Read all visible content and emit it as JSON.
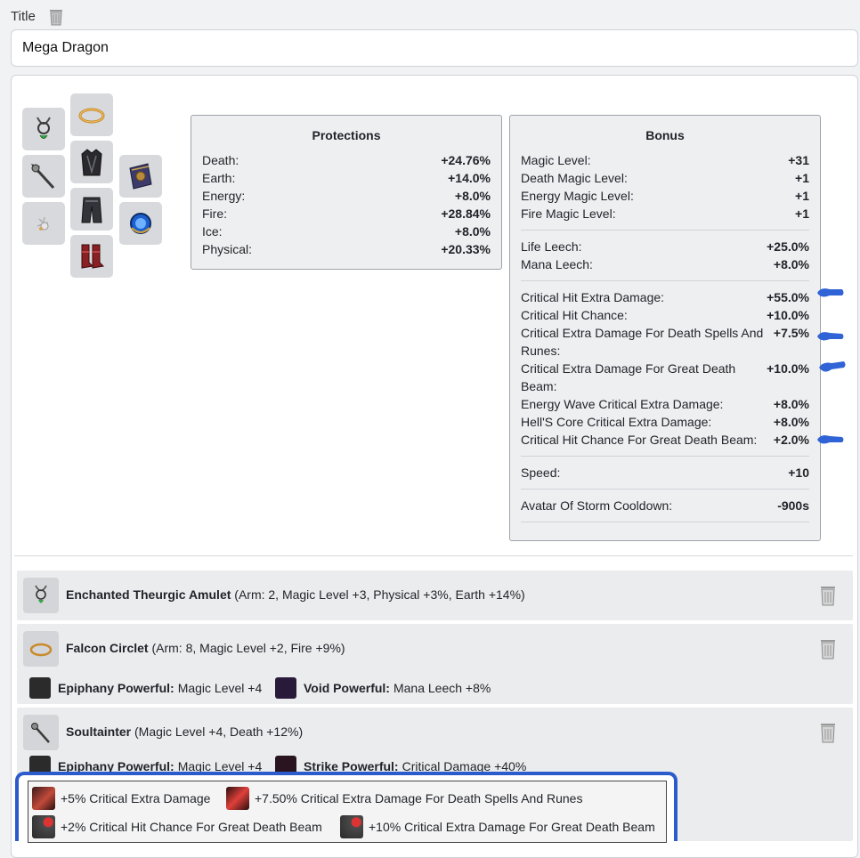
{
  "title_label": "Title",
  "title_value": "Mega Dragon",
  "protections": {
    "heading": "Protections",
    "rows": [
      {
        "k": "Death:",
        "v": "+24.76%"
      },
      {
        "k": "Earth:",
        "v": "+14.0%"
      },
      {
        "k": "Energy:",
        "v": "+8.0%"
      },
      {
        "k": "Fire:",
        "v": "+28.84%"
      },
      {
        "k": "Ice:",
        "v": "+8.0%"
      },
      {
        "k": "Physical:",
        "v": "+20.33%"
      }
    ]
  },
  "bonus": {
    "heading": "Bonus",
    "groups": [
      [
        {
          "k": "Magic Level:",
          "v": "+31"
        },
        {
          "k": "Death Magic Level:",
          "v": "+1"
        },
        {
          "k": "Energy Magic Level:",
          "v": "+1"
        },
        {
          "k": "Fire Magic Level:",
          "v": "+1"
        }
      ],
      [
        {
          "k": "Life Leech:",
          "v": "+25.0%"
        },
        {
          "k": "Mana Leech:",
          "v": "+8.0%"
        }
      ],
      [
        {
          "k": "Critical Hit Extra Damage:",
          "v": "+55.0%"
        },
        {
          "k": "Critical Hit Chance:",
          "v": "+10.0%"
        },
        {
          "k": "Critical Extra Damage For Death Spells And Runes:",
          "v": "+7.5%"
        },
        {
          "k": "Critical Extra Damage For Great Death Beam:",
          "v": "+10.0%"
        },
        {
          "k": "Energy Wave Critical Extra Damage:",
          "v": "+8.0%"
        },
        {
          "k": "Hell'S Core Critical Extra Damage:",
          "v": "+8.0%"
        },
        {
          "k": "Critical Hit Chance For Great Death Beam:",
          "v": "+2.0%"
        }
      ],
      [
        {
          "k": "Speed:",
          "v": "+10"
        }
      ],
      [
        {
          "k": "Avatar Of Storm Cooldown:",
          "v": "-900s"
        }
      ]
    ]
  },
  "items": [
    {
      "name": "Enchanted Theurgic Amulet",
      "stats": "(Arm: 2, Magic Level +3, Physical +3%, Earth +14%)"
    },
    {
      "name": "Falcon Circlet",
      "stats": "(Arm: 8, Magic Level +2, Fire +9%)",
      "imbuements": [
        {
          "name": "Epiphany Powerful:",
          "effect": "Magic Level +4"
        },
        {
          "name": "Void Powerful:",
          "effect": "Mana Leech +8%"
        }
      ]
    },
    {
      "name": "Soultainter",
      "stats": "(Magic Level +4, Death +12%)",
      "imbuements": [
        {
          "name": "Epiphany Powerful:",
          "effect": "Magic Level +4"
        },
        {
          "name": "Strike Powerful:",
          "effect": "Critical Damage +40%"
        }
      ]
    }
  ],
  "gems": [
    "+5% Critical Extra Damage",
    "+7.50% Critical Extra Damage For Death Spells And Runes",
    "+2% Critical Hit Chance For Great Death Beam",
    "+10% Critical Extra Damage For Great Death Beam"
  ],
  "colors": {
    "highlight": "#2c5bcc",
    "arrow": "#2f63d6"
  }
}
